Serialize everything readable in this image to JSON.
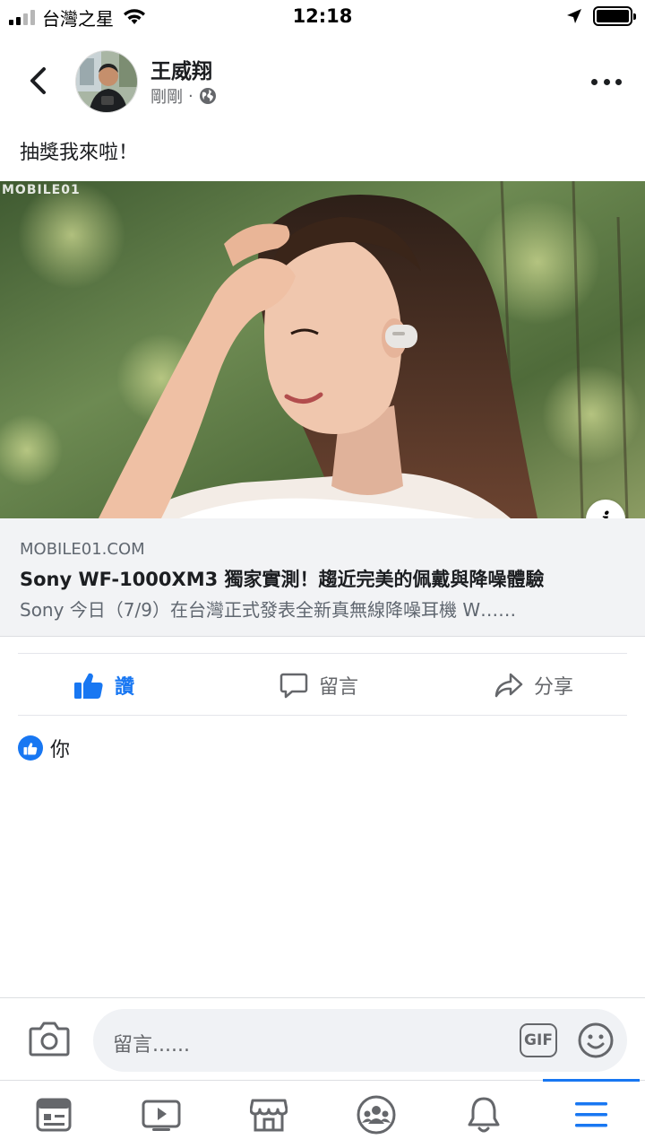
{
  "status_bar": {
    "carrier": "台灣之星",
    "time": "12:18",
    "battery_level": 1.0,
    "signal_bars": 2
  },
  "header": {
    "back_icon": "chevron-left-icon",
    "author_name": "王威翔",
    "timestamp": "剛剛",
    "separator": "·",
    "privacy_icon": "globe-icon",
    "more_icon": "more-horizontal-icon"
  },
  "post": {
    "text": "抽獎我來啦！"
  },
  "link_preview": {
    "watermark": "MOBILE01",
    "domain": "MOBILE01.COM",
    "title": "Sony WF-1000XM3 獨家實測！趨近完美的佩戴與降噪體驗",
    "description": "Sony 今日（7/9）在台灣正式發表全新真無線降噪耳機 W……",
    "info_label": "i"
  },
  "actions": {
    "like_label": "讚",
    "comment_label": "留言",
    "share_label": "分享",
    "like_color": "#1877f2"
  },
  "reactions": {
    "text": "你"
  },
  "composer": {
    "placeholder": "留言......",
    "gif_label": "GIF"
  },
  "tabbar": {
    "tabs": [
      "news-feed-icon",
      "watch-icon",
      "marketplace-icon",
      "groups-icon",
      "notifications-icon",
      "menu-icon"
    ],
    "active_index": 5
  },
  "colors": {
    "accent": "#1877f2",
    "secondary_text": "#65676b",
    "card_background": "#f2f3f5"
  }
}
